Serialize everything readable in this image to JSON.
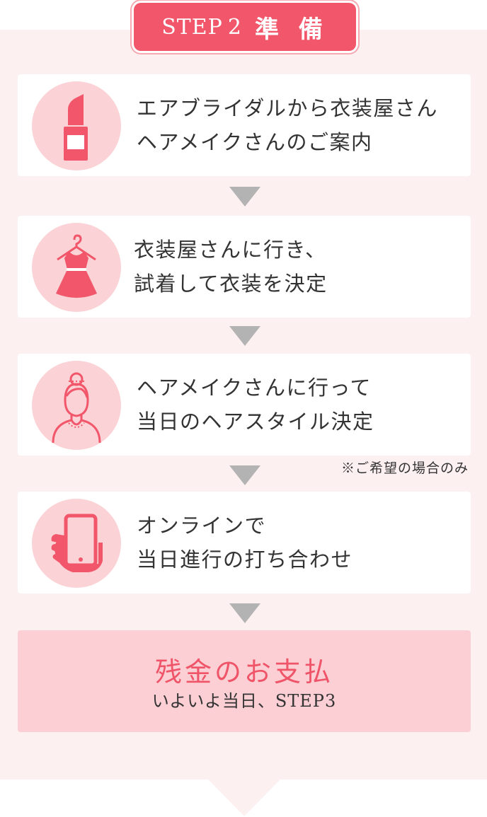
{
  "header": {
    "step_label": "STEP 2",
    "step_title": "準 備"
  },
  "steps": [
    {
      "icon": "lipstick-icon",
      "line1": "エアブライダルから衣装屋さん",
      "line2": "ヘアメイクさんのご案内"
    },
    {
      "icon": "dress-icon",
      "line1": "衣装屋さんに行き、",
      "line2": "試着して衣装を決定"
    },
    {
      "icon": "bride-icon",
      "line1": "ヘアメイクさんに行って",
      "line2": "当日のヘアスタイル決定"
    },
    {
      "icon": "smartphone-icon",
      "line1": "オンラインで",
      "line2": "当日進行の打ち合わせ"
    }
  ],
  "note": "※ご希望の場合のみ",
  "final": {
    "title": "残金のお支払",
    "subtitle": "いよいよ当日、STEP3"
  },
  "colors": {
    "accent": "#f2566a",
    "panel_bg": "#fdf0f1",
    "icon_circle": "#fbd3d6",
    "final_bg": "#fccfd4",
    "arrow": "#b3b3b3"
  }
}
